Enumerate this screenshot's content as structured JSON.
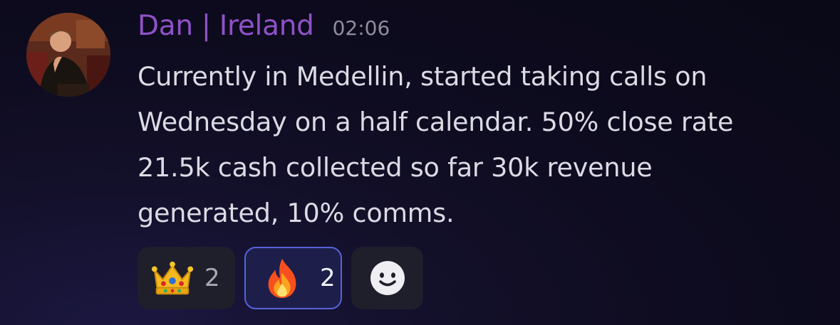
{
  "message": {
    "author": "Dan | Ireland",
    "timestamp": "02:06",
    "author_color": "#8e52c6",
    "content_lines": [
      "Currently in Medellin, started taking calls on",
      "Wednesday on a half calendar. 50% close rate",
      "21.5k cash collected so far 30k revenue",
      "generated, 10% comms."
    ]
  },
  "reactions": [
    {
      "emoji": "crown-emoji",
      "count": "2",
      "selected": false
    },
    {
      "emoji": "fire-emoji",
      "count": "2",
      "selected": true
    }
  ],
  "add_reaction": {
    "icon": "smiley-add-reaction-icon"
  },
  "colors": {
    "background": "#0e0c20",
    "selected_border": "#5763d8",
    "reaction_bg": "#1f1e2b"
  }
}
